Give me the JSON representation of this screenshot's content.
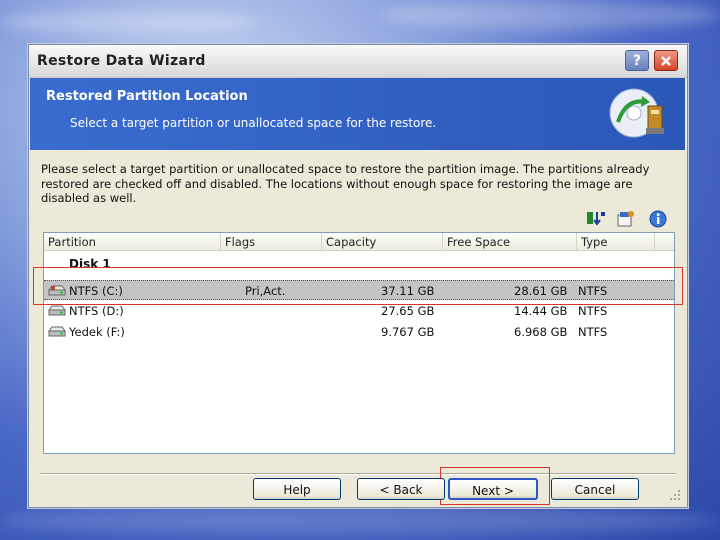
{
  "window": {
    "title": "Restore Data Wizard"
  },
  "header": {
    "title": "Restored Partition Location",
    "subtitle": "Select a target partition or unallocated space for the restore."
  },
  "instructions": "Please select a target partition or unallocated space to restore the partition image. The partitions already restored are checked off and disabled. The locations without enough space for restoring the image are disabled as well.",
  "table": {
    "columns": [
      "Partition",
      "Flags",
      "Capacity",
      "Free Space",
      "Type"
    ],
    "disk_label": "Disk 1",
    "rows": [
      {
        "partition": "NTFS (C:)",
        "flags": "Pri,Act.",
        "capacity": "37.11 GB",
        "free": "28.61 GB",
        "type": "NTFS",
        "selected": true
      },
      {
        "partition": "NTFS (D:)",
        "flags": "",
        "capacity": "27.65 GB",
        "free": "14.44 GB",
        "type": "NTFS",
        "selected": false
      },
      {
        "partition": "Yedek (F:)",
        "flags": "",
        "capacity": "9.767 GB",
        "free": "6.968 GB",
        "type": "NTFS",
        "selected": false
      }
    ]
  },
  "buttons": {
    "help": "Help",
    "back": "< Back",
    "next": "Next >",
    "cancel": "Cancel"
  },
  "icons": [
    "help-icon",
    "close-icon",
    "wizard-restore-icon",
    "sort-icon",
    "properties-icon",
    "info-icon",
    "drive-icon",
    "resize-grip-icon"
  ],
  "colors": {
    "header_blue": "#2f61c4",
    "highlight_red": "#d9342b",
    "selection_gray": "#c4c4c4"
  }
}
